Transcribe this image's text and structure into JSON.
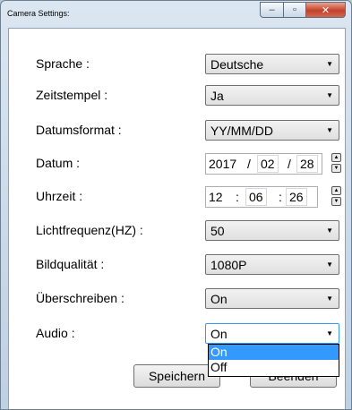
{
  "window": {
    "title": "Camera Settings:",
    "minimize": "‒",
    "maximize": "▫",
    "close": "✕"
  },
  "settings": {
    "language": {
      "label": "Sprache :",
      "value": "Deutsche"
    },
    "timestamp": {
      "label": "Zeitstempel :",
      "value": "Ja"
    },
    "date_format": {
      "label": "Datumsformat :",
      "value": "YY/MM/DD"
    },
    "date": {
      "label": "Datum :",
      "year": "2017",
      "month": "02",
      "day": "28",
      "separator": "/"
    },
    "time": {
      "label": "Uhrzeit :",
      "hour": "12",
      "minute": "06",
      "second": "26",
      "separator": ":"
    },
    "light_frequency": {
      "label": "Lichtfrequenz(HZ) :",
      "value": "50"
    },
    "image_quality": {
      "label": "Bildqualität :",
      "value": "1080P"
    },
    "overwrite": {
      "label": "Überschreiben :",
      "value": "On"
    },
    "audio": {
      "label": "Audio :",
      "value": "On",
      "options": [
        "On",
        "Off"
      ]
    }
  },
  "buttons": {
    "save": "Speichern",
    "close": "Beenden"
  },
  "icons": {
    "dropdown_arrow": "▼",
    "spin_up": "▲",
    "spin_down": "▼"
  }
}
